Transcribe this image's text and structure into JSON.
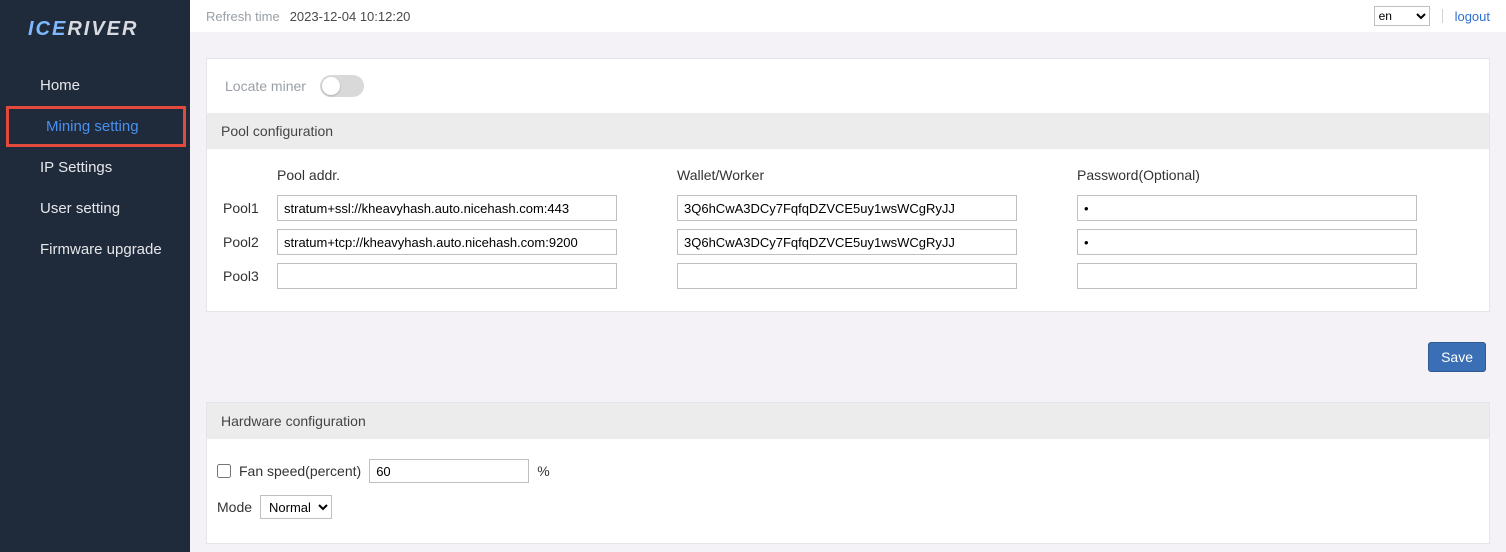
{
  "brand": {
    "prefix": "ICE",
    "suffix": "RIVER"
  },
  "sidebar": {
    "items": [
      {
        "label": "Home"
      },
      {
        "label": "Mining setting"
      },
      {
        "label": "IP Settings"
      },
      {
        "label": "User setting"
      },
      {
        "label": "Firmware upgrade"
      }
    ],
    "active_index": 1
  },
  "topbar": {
    "refresh_label": "Refresh time",
    "refresh_time": "2023-12-04 10:12:20",
    "lang_value": "en",
    "logout_label": "logout"
  },
  "locate": {
    "label": "Locate miner",
    "on": false
  },
  "pool": {
    "section_title": "Pool configuration",
    "headers": {
      "addr": "Pool addr.",
      "wallet": "Wallet/Worker",
      "password": "Password(Optional)"
    },
    "rows": [
      {
        "label": "Pool1",
        "addr": "stratum+ssl://kheavyhash.auto.nicehash.com:443",
        "wallet": "3Q6hCwA3DCy7FqfqDZVCE5uy1wsWCgRyJJ",
        "password": "x"
      },
      {
        "label": "Pool2",
        "addr": "stratum+tcp://kheavyhash.auto.nicehash.com:9200",
        "wallet": "3Q6hCwA3DCy7FqfqDZVCE5uy1wsWCgRyJJ",
        "password": "x"
      },
      {
        "label": "Pool3",
        "addr": "",
        "wallet": "",
        "password": ""
      }
    ]
  },
  "save_label": "Save",
  "hardware": {
    "section_title": "Hardware configuration",
    "fan_checked": false,
    "fan_label": "Fan speed(percent)",
    "fan_value": "60",
    "percent_sign": "%",
    "mode_label": "Mode",
    "mode_value": "Normal",
    "mode_options": [
      "Normal"
    ]
  }
}
